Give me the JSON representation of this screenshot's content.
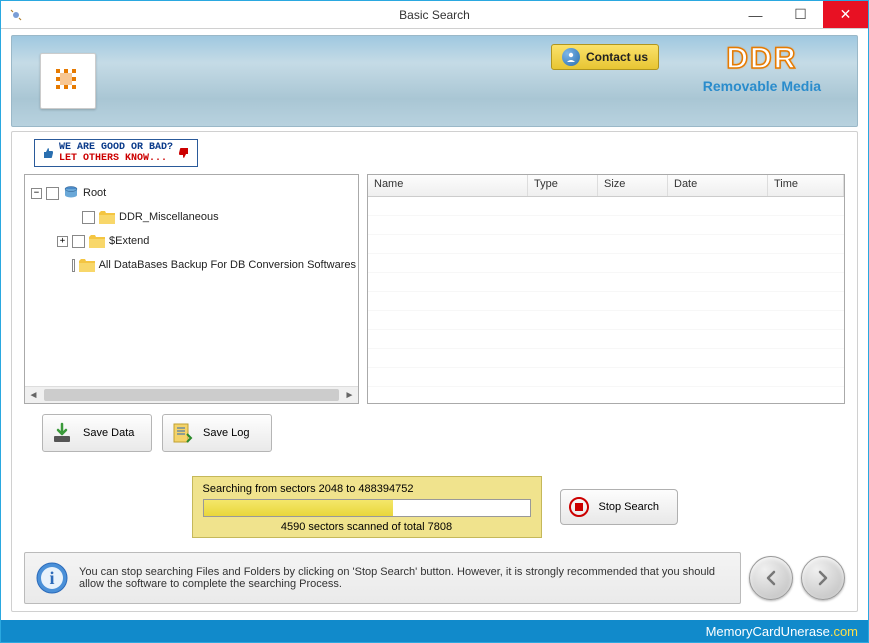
{
  "window": {
    "title": "Basic Search"
  },
  "header": {
    "contact_label": "Contact us",
    "brand_main": "DDR",
    "brand_sub": "Removable Media"
  },
  "promo": {
    "line1": "WE ARE GOOD OR BAD?",
    "line2": "LET OTHERS KNOW..."
  },
  "tree": {
    "root": "Root",
    "items": [
      {
        "label": "DDR_Miscellaneous",
        "expandable": false
      },
      {
        "label": "$Extend",
        "expandable": true
      },
      {
        "label": "All DataBases Backup For DB Conversion Softwares",
        "expandable": false
      }
    ]
  },
  "list": {
    "columns": [
      "Name",
      "Type",
      "Size",
      "Date",
      "Time"
    ]
  },
  "buttons": {
    "save_data": "Save Data",
    "save_log": "Save Log",
    "stop_search": "Stop Search"
  },
  "progress": {
    "title": "Searching from sectors 2048 to 488394752",
    "subtitle": "4590  sectors scanned of total 7808",
    "percent": 58
  },
  "info": {
    "text": "You can stop searching Files and Folders by clicking on 'Stop Search' button. However, it is strongly recommended that you should allow the software to complete the searching Process."
  },
  "footer": {
    "site": "MemoryCardUnerase",
    "tld": ".com"
  }
}
